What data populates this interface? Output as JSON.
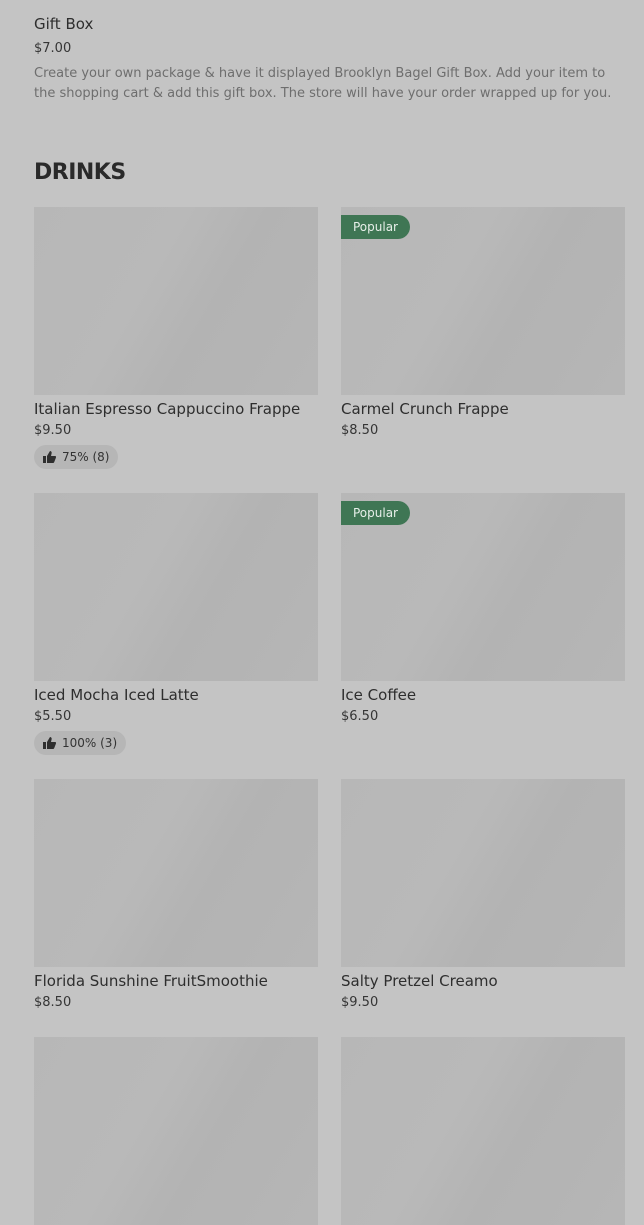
{
  "gift": {
    "title": "Gift Box",
    "price": "$7.00",
    "description": "Create your own package & have it displayed Brooklyn Bagel Gift Box. Add your item to the shopping cart & add this gift box. The store will have your order wrapped up for you."
  },
  "section": {
    "title": "DRINKS"
  },
  "colors": {
    "popular_badge": "#3f7654",
    "background": "#c4c4c4"
  },
  "items": [
    {
      "name": "Italian Espresso Cappuccino Frappe",
      "price": "$9.50",
      "badge": "",
      "rating": "75% (8)"
    },
    {
      "name": "Carmel Crunch Frappe",
      "price": "$8.50",
      "badge": "Popular",
      "rating": ""
    },
    {
      "name": "Iced Mocha Iced Latte",
      "price": "$5.50",
      "badge": "",
      "rating": "100% (3)"
    },
    {
      "name": "Ice Coffee",
      "price": "$6.50",
      "badge": "Popular",
      "rating": ""
    },
    {
      "name": "Florida Sunshine FruitSmoothie",
      "price": "$8.50",
      "badge": "",
      "rating": ""
    },
    {
      "name": "Salty Pretzel Creamo",
      "price": "$9.50",
      "badge": "",
      "rating": ""
    },
    {
      "name": "",
      "price": "",
      "badge": "",
      "rating": ""
    },
    {
      "name": "",
      "price": "",
      "badge": "",
      "rating": ""
    }
  ]
}
